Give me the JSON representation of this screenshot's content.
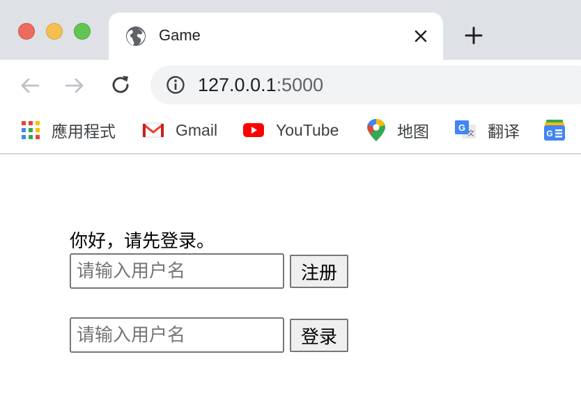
{
  "browser": {
    "tab": {
      "title": "Game",
      "icon": "globe-icon"
    },
    "new_tab_icon": "plus-icon",
    "address": {
      "host": "127.0.0.1",
      "port": ":5000"
    },
    "bookmarks": [
      {
        "label": "應用程式",
        "icon": "apps-grid-icon"
      },
      {
        "label": "Gmail",
        "icon": "gmail-icon"
      },
      {
        "label": "YouTube",
        "icon": "youtube-icon"
      },
      {
        "label": "地图",
        "icon": "maps-pin-icon"
      },
      {
        "label": "翻译",
        "icon": "translate-icon"
      },
      {
        "label": "",
        "icon": "google-news-icon"
      }
    ],
    "traffic_light_colors": {
      "close": "#ed6a5e",
      "minimize": "#f5bf4f",
      "maximize": "#61c554"
    }
  },
  "page": {
    "greeting": "你好，请先登录。",
    "register": {
      "placeholder": "请输入用户名",
      "button_label": "注册"
    },
    "login": {
      "placeholder": "请输入用户名",
      "button_label": "登录"
    }
  }
}
